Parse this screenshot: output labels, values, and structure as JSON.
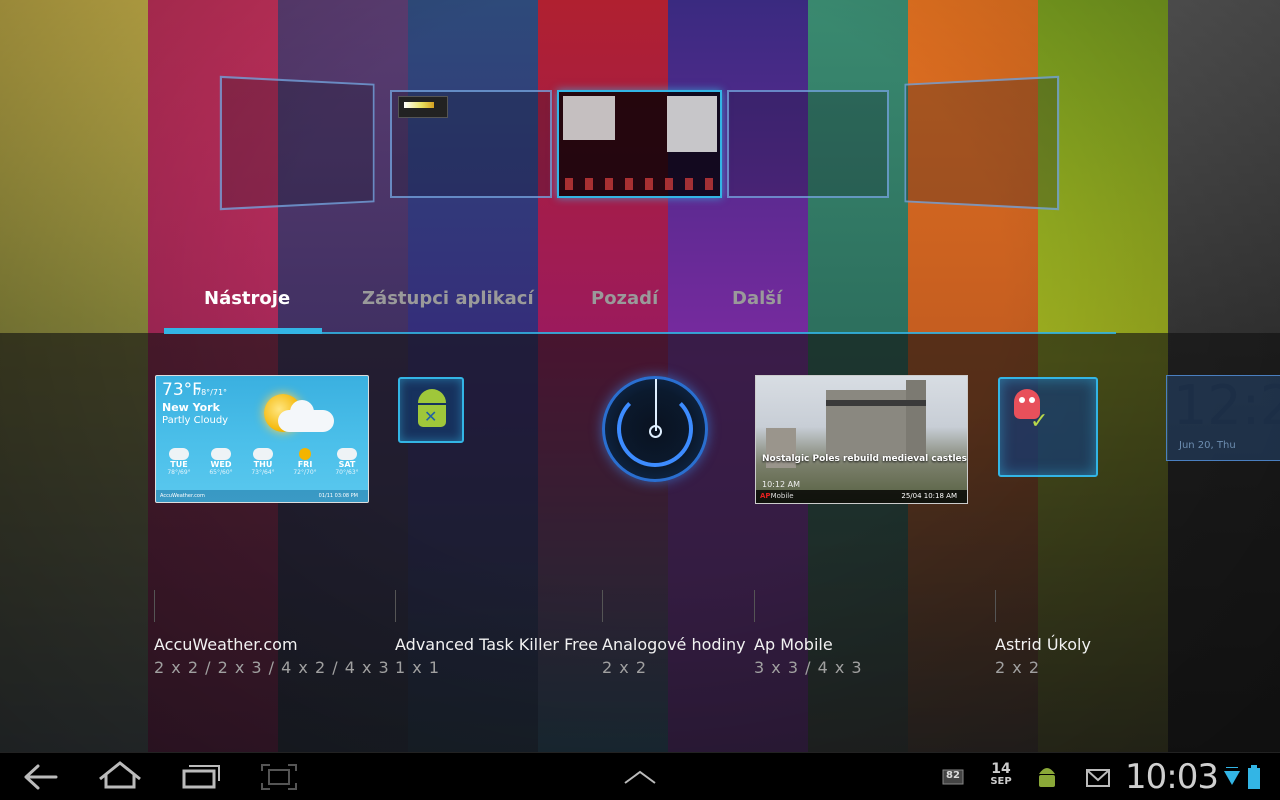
{
  "tabs": [
    {
      "label": "Nástroje",
      "active": true
    },
    {
      "label": "Zástupci aplikací",
      "active": false
    },
    {
      "label": "Pozadí",
      "active": false
    },
    {
      "label": "Další",
      "active": false
    }
  ],
  "widgets": [
    {
      "name": "AccuWeather.com",
      "size": "2 x 2 / 2 x 3 / 4 x 2 / 4 x 3"
    },
    {
      "name": "Advanced Task Killer Free",
      "size": "1 x 1"
    },
    {
      "name": "Analogové hodiny",
      "size": "2 x 2"
    },
    {
      "name": "Ap Mobile",
      "size": "3 x 3 / 4 x 3"
    },
    {
      "name": "Astrid Úkoly",
      "size": "2 x 2"
    }
  ],
  "accuweather_preview": {
    "temp": "73°F",
    "hilo": "78°/71°",
    "city": "New York",
    "condition": "Partly Cloudy",
    "days": [
      {
        "name": "TUE",
        "temp": "78°/69°",
        "icon": "partly-cloudy-icon"
      },
      {
        "name": "WED",
        "temp": "65°/60°",
        "icon": "rain-icon"
      },
      {
        "name": "THU",
        "temp": "73°/64°",
        "icon": "partly-cloudy-icon"
      },
      {
        "name": "FRI",
        "temp": "72°/70°",
        "icon": "sun-icon"
      },
      {
        "name": "SAT",
        "temp": "70°/63°",
        "icon": "rain-icon"
      }
    ],
    "brand": "AccuWeather.com",
    "updated": "01/11 03:08 PM"
  },
  "apmobile_preview": {
    "headline": "Nostalgic Poles rebuild medieval castles",
    "time": "10:12 AM",
    "brand_ap": "AP",
    "brand_rest": "Mobile",
    "date": "25/04 10:18 AM"
  },
  "digital_clock_preview": {
    "time": "12:2",
    "date": "Jun 20, Thu"
  },
  "statusbar": {
    "battery_percent": "82",
    "date_day": "14",
    "date_month": "SEP",
    "time": "10:03"
  },
  "colors": {
    "accent": "#33b5e5",
    "tab_inactive": "#9a9a9a",
    "size_text": "#a0a0a0"
  }
}
